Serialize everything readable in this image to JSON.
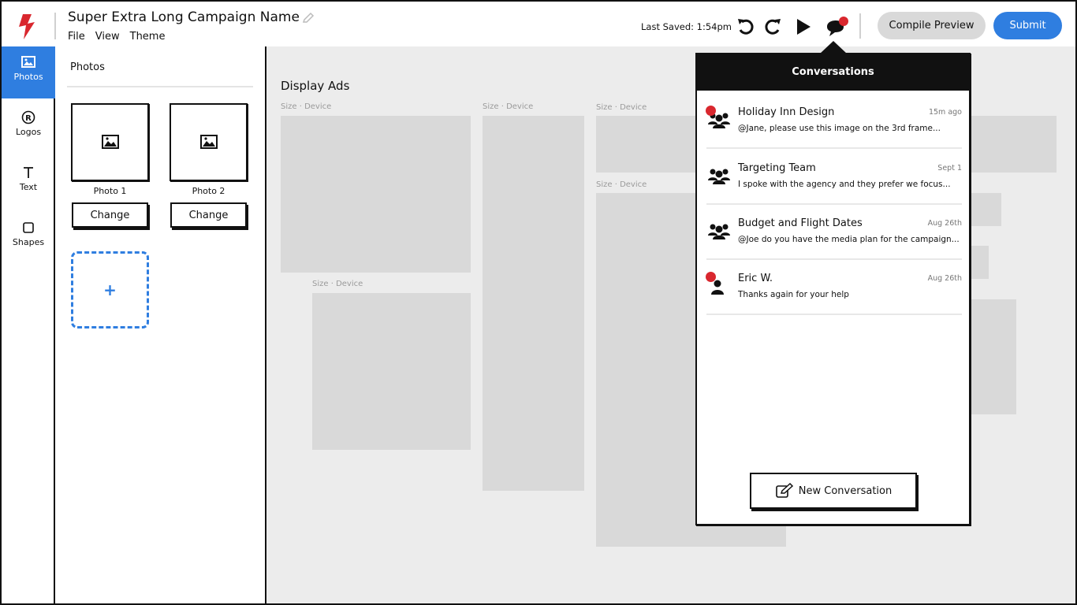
{
  "header": {
    "campaign_name": "Super Extra Long Campaign Name",
    "menu": [
      "File",
      "View",
      "Theme"
    ],
    "last_saved": "Last Saved: 1:54pm",
    "compile_label": "Compile Preview",
    "submit_label": "Submit"
  },
  "rail": {
    "items": [
      {
        "label": "Photos",
        "icon": "image-icon",
        "active": true
      },
      {
        "label": "Logos",
        "icon": "registered-icon",
        "active": false
      },
      {
        "label": "Text",
        "icon": "text-icon",
        "active": false
      },
      {
        "label": "Shapes",
        "icon": "square-icon",
        "active": false
      }
    ]
  },
  "panel": {
    "title": "Photos",
    "photos": [
      {
        "label": "Photo 1",
        "change_label": "Change"
      },
      {
        "label": "Photo 2",
        "change_label": "Change"
      }
    ],
    "add_symbol": "+"
  },
  "canvas": {
    "title": "Display Ads",
    "ad_label": "Size · Device"
  },
  "conversations": {
    "title": "Conversations",
    "items": [
      {
        "name": "Holiday Inn Design",
        "time": "15m ago",
        "message": "@Jane, please use this image on the 3rd frame...",
        "unread": true,
        "group": true
      },
      {
        "name": "Targeting Team",
        "time": "Sept 1",
        "message": "I spoke with the agency and they prefer we focus...",
        "unread": false,
        "group": true
      },
      {
        "name": "Budget and Flight Dates",
        "time": "Aug 26th",
        "message": "@Joe do you have the media plan for the campaign...",
        "unread": false,
        "group": true
      },
      {
        "name": "Eric W.",
        "time": "Aug 26th",
        "message": "Thanks again for your help",
        "unread": true,
        "group": false
      }
    ],
    "new_label": "New Conversation"
  },
  "colors": {
    "accent": "#2f7ee0",
    "notification": "#d9272e",
    "placeholder": "#d9d9d9"
  }
}
